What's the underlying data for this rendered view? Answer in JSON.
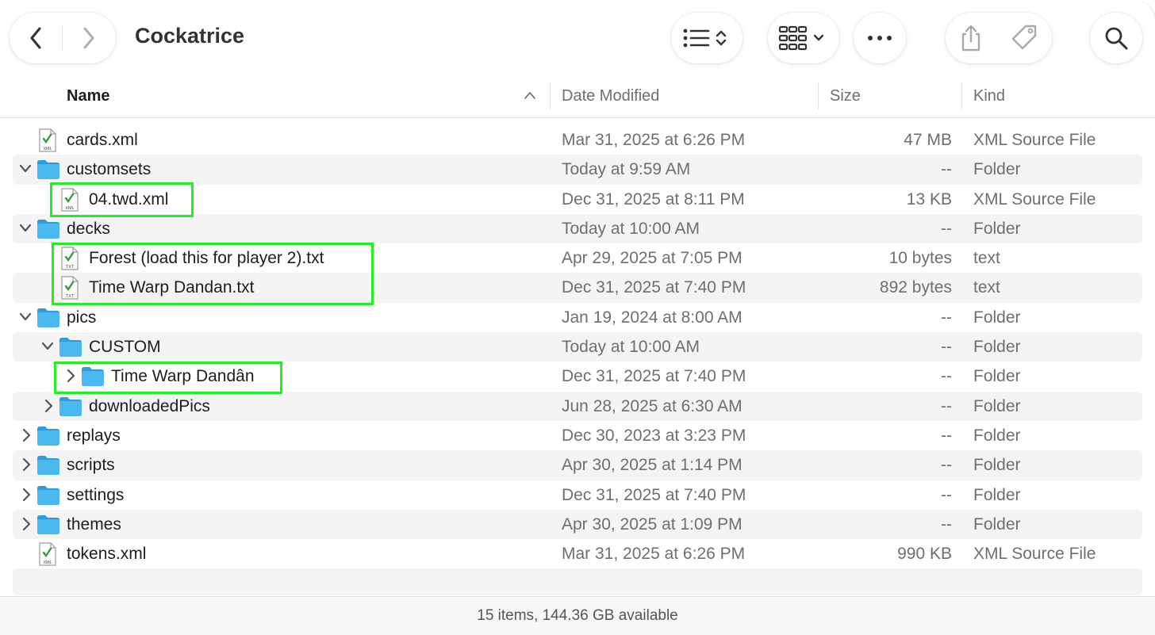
{
  "window": {
    "title": "Cockatrice"
  },
  "toolbar": {
    "back_icon": "chevron-left-icon",
    "forward_icon": "chevron-right-icon",
    "list_view_icon": "list-icon",
    "group_icon": "grid-icon",
    "more_icon": "ellipsis-icon",
    "share_icon": "share-icon",
    "tag_icon": "tag-icon",
    "search_icon": "search-icon"
  },
  "columns": {
    "name": "Name",
    "date": "Date Modified",
    "size": "Size",
    "kind": "Kind"
  },
  "rows": [
    {
      "name": "cards.xml",
      "date": "Mar 31, 2025 at 6:26 PM",
      "size": "47 MB",
      "kind": "XML Source File",
      "type": "xml",
      "depth": 0,
      "disclosure": "none"
    },
    {
      "name": "customsets",
      "date": "Today at 9:59 AM",
      "size": "--",
      "kind": "Folder",
      "type": "folder",
      "depth": 0,
      "disclosure": "open"
    },
    {
      "name": "04.twd.xml",
      "date": "Dec 31, 2025 at 8:11 PM",
      "size": "13 KB",
      "kind": "XML Source File",
      "type": "xml",
      "depth": 1,
      "disclosure": "none"
    },
    {
      "name": "decks",
      "date": "Today at 10:00 AM",
      "size": "--",
      "kind": "Folder",
      "type": "folder",
      "depth": 0,
      "disclosure": "open"
    },
    {
      "name": "Forest (load this for player 2).txt",
      "date": "Apr 29, 2025 at 7:05 PM",
      "size": "10 bytes",
      "kind": "text",
      "type": "txt",
      "depth": 1,
      "disclosure": "none"
    },
    {
      "name": "Time Warp Dandan.txt",
      "date": "Dec 31, 2025 at 7:40 PM",
      "size": "892 bytes",
      "kind": "text",
      "type": "txt",
      "depth": 1,
      "disclosure": "none"
    },
    {
      "name": "pics",
      "date": "Jan 19, 2024 at 8:00 AM",
      "size": "--",
      "kind": "Folder",
      "type": "folder",
      "depth": 0,
      "disclosure": "open"
    },
    {
      "name": "CUSTOM",
      "date": "Today at 10:00 AM",
      "size": "--",
      "kind": "Folder",
      "type": "folder",
      "depth": 1,
      "disclosure": "open"
    },
    {
      "name": "Time Warp Dandân",
      "date": "Dec 31, 2025 at 7:40 PM",
      "size": "--",
      "kind": "Folder",
      "type": "folder",
      "depth": 2,
      "disclosure": "closed"
    },
    {
      "name": "downloadedPics",
      "date": "Jun 28, 2025 at 6:30 AM",
      "size": "--",
      "kind": "Folder",
      "type": "folder",
      "depth": 1,
      "disclosure": "closed"
    },
    {
      "name": "replays",
      "date": "Dec 30, 2023 at 3:23 PM",
      "size": "--",
      "kind": "Folder",
      "type": "folder",
      "depth": 0,
      "disclosure": "closed"
    },
    {
      "name": "scripts",
      "date": "Apr 30, 2025 at 1:14 PM",
      "size": "--",
      "kind": "Folder",
      "type": "folder",
      "depth": 0,
      "disclosure": "closed"
    },
    {
      "name": "settings",
      "date": "Dec 31, 2025 at 7:40 PM",
      "size": "--",
      "kind": "Folder",
      "type": "folder",
      "depth": 0,
      "disclosure": "closed"
    },
    {
      "name": "themes",
      "date": "Apr 30, 2025 at 1:09 PM",
      "size": "--",
      "kind": "Folder",
      "type": "folder",
      "depth": 0,
      "disclosure": "closed"
    },
    {
      "name": "tokens.xml",
      "date": "Mar 31, 2025 at 6:26 PM",
      "size": "990 KB",
      "kind": "XML Source File",
      "type": "xml",
      "depth": 0,
      "disclosure": "none"
    }
  ],
  "highlight_color": "#22ee22",
  "folder_color": "#4cb8f0",
  "status": {
    "text": "15 items, 144.36 GB available"
  }
}
